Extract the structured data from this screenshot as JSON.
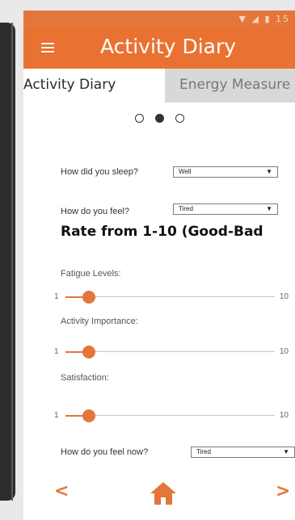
{
  "status_bar": {
    "time": "15"
  },
  "app_bar": {
    "title": "Activity Diary"
  },
  "tabs": [
    {
      "label": "Activity Diary",
      "active": true
    },
    {
      "label": "Energy Measure",
      "active": false
    }
  ],
  "pager": {
    "pages": 3,
    "current": 2
  },
  "questions": {
    "sleep": {
      "label": "How did you sleep?",
      "value": "Well"
    },
    "feel": {
      "label": "How do you feel?",
      "value": "Tired"
    },
    "feel_now": {
      "label": "How do you feel now?",
      "value": "Tired"
    }
  },
  "rate_title": "Rate from 1-10 (Good-Bad",
  "sliders": [
    {
      "label": "Fatigue Levels:",
      "min": "1",
      "max": "10",
      "value": 2
    },
    {
      "label": "Activity Importance:",
      "min": "1",
      "max": "10",
      "value": 2
    },
    {
      "label": "Satisfaction:",
      "min": "1",
      "max": "10",
      "value": 2
    }
  ],
  "nav": {
    "prev_glyph": "<",
    "next_glyph": ">",
    "home_icon": "home-icon"
  },
  "colors": {
    "accent": "#e97232",
    "tab_inactive": "#d8d8d8"
  }
}
